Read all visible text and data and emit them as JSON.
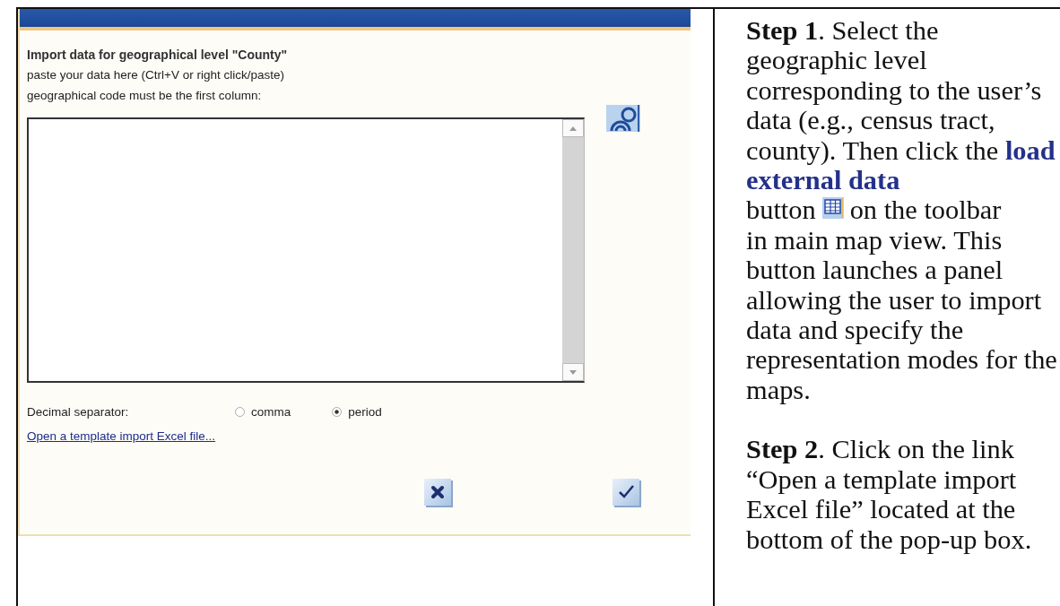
{
  "dialog": {
    "title": "Import data for geographical level \"County\"",
    "instructions": [
      "paste your data here (Ctrl+V or right click/paste)",
      "geographical code must be the first column:"
    ],
    "decimal_separator": {
      "label": "Decimal separator:",
      "options": [
        {
          "label": "comma",
          "selected": false
        },
        {
          "label": "period",
          "selected": true
        }
      ]
    },
    "template_link": "Open a template import Excel file...",
    "buttons": [
      {
        "kind": "cancel"
      },
      {
        "kind": "ok"
      }
    ]
  },
  "notes": [
    {
      "blocks": [
        {
          "kind": "paragraph",
          "text": "**Step 1**. Select the geographic level corresponding to the user’s data (e.g., census tract, county). Then click the",
          "highlight": "load external data"
        },
        {
          "kind": "icon_row",
          "before": "button",
          "after": "on the toolbar"
        },
        {
          "kind": "paragraph",
          "text": "in main map view. This button launches a panel allowing the user to import data and specify the representation modes for the maps."
        }
      ]
    },
    {
      "blocks": [
        {
          "kind": "paragraph",
          "text": "**Step 2**. Click on the link “Open a template import Excel file” located at the bottom of the pop-up box."
        }
      ]
    }
  ]
}
